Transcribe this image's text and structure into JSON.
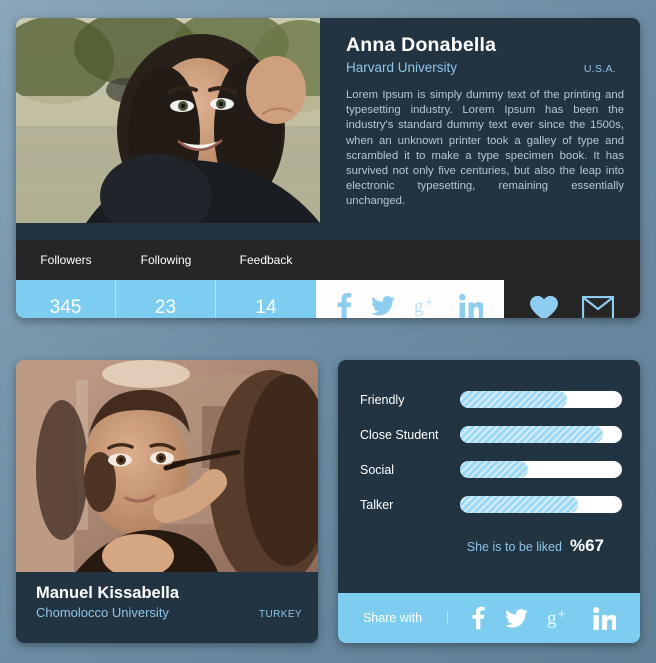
{
  "theme": {
    "page_bg": "#6e8ea5",
    "card_bg": "#223441",
    "accent_blue": "#7dcdf0",
    "link_blue": "#8ec4e6",
    "dark_strip": "#262626"
  },
  "card_top": {
    "photo_alt": "smiling-woman-outdoors-photo",
    "name": "Anna Donabella",
    "university": "Harvard University",
    "country": "U.S.A.",
    "bio": "Lorem Ipsum is simply dummy text of the printing and typesetting industry. Lorem Ipsum has been the industry's standard dummy text ever since the 1500s, when an unknown printer took a galley of type and scrambled it to make a type specimen book. It has survived not only five centuries, but also the leap into electronic typesetting, remaining essentially unchanged.",
    "stats": [
      {
        "label": "Followers",
        "value": "345"
      },
      {
        "label": "Following",
        "value": "23"
      },
      {
        "label": "Feedback",
        "value": "14"
      }
    ],
    "social": [
      {
        "icon": "facebook-icon",
        "label": "f"
      },
      {
        "icon": "twitter-icon",
        "label": "twitter"
      },
      {
        "icon": "google-plus-icon",
        "label": "g+"
      },
      {
        "icon": "linkedin-icon",
        "label": "in"
      }
    ],
    "actions": [
      {
        "icon": "heart-icon",
        "label": "like"
      },
      {
        "icon": "envelope-icon",
        "label": "message"
      }
    ]
  },
  "card_bottom_left": {
    "photo_alt": "woman-applying-makeup-photo",
    "name": "Manuel Kissabella",
    "university": "Chomolocco University",
    "country": "TURKEY"
  },
  "card_bottom_right": {
    "traits": [
      {
        "label": "Friendly",
        "percent": 66
      },
      {
        "label": "Close Student",
        "percent": 88
      },
      {
        "label": "Social",
        "percent": 42
      },
      {
        "label": "Talker",
        "percent": 73
      }
    ],
    "liked_text": "She is to be liked",
    "liked_percent": "%67",
    "share_label": "Share with",
    "share_icons": [
      {
        "icon": "facebook-icon",
        "label": "f"
      },
      {
        "icon": "twitter-icon",
        "label": "twitter"
      },
      {
        "icon": "google-plus-icon",
        "label": "g+"
      },
      {
        "icon": "linkedin-icon",
        "label": "in"
      }
    ]
  }
}
